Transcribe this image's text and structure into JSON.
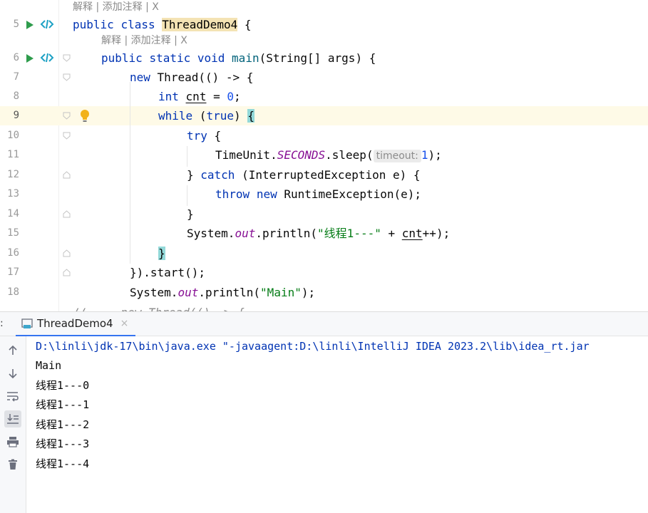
{
  "editor": {
    "hints": [
      "解释 | 添加注释 | X",
      "解释 | 添加注释 | X"
    ],
    "line_numbers": [
      "5",
      "6",
      "7",
      "8",
      "9",
      "10",
      "11",
      "12",
      "13",
      "14",
      "15",
      "16",
      "17",
      "18"
    ],
    "current_line": "9",
    "tokens": {
      "public": "public",
      "class": "class",
      "static": "static",
      "void": "void",
      "new": "new",
      "int": "int",
      "while": "while",
      "true": "true",
      "try": "try",
      "catch": "catch",
      "throw": "throw",
      "class_name": "ThreadDemo4",
      "main": "main",
      "thread": "Thread",
      "main_params": "(String[] args) {",
      "brace_open": " {",
      "thread_lambda": "(() -> {",
      "cnt": "cnt",
      "eq_zero_pre": " = ",
      "zero": "0",
      "semi": ";",
      "while_paren": " (",
      "close_paren": ") ",
      "brace": "{",
      "try_brace": " {",
      "timeunit": "TimeUnit.",
      "seconds": "SECONDS",
      "sleep": ".sleep(",
      "timeout_hint": "timeout:",
      "one": "1",
      "sleep_end": ");",
      "close_brace_catch": "} ",
      "catch_args": " (InterruptedException e) {",
      "runtime_ex": " RuntimeException(e);",
      "close_brace": "}",
      "system": "System.",
      "out": "out",
      "println": ".println(",
      "str_thread": "\"线程1---\"",
      "plus": " + ",
      "inc": "++);",
      "close_start": "}).start();",
      "str_main": "\"Main\"",
      "println_end": ");",
      "partial_line": "//     new Thread(() -> {"
    }
  },
  "run": {
    "colon": ":",
    "tab_title": "ThreadDemo4",
    "tab_close": "×",
    "toolbar": [
      "up-arrow",
      "down-arrow",
      "soft-wrap",
      "scroll-to-end",
      "print",
      "trash"
    ],
    "console_lines": [
      "D:\\linli\\jdk-17\\bin\\java.exe \"-javaagent:D:\\linli\\IntelliJ IDEA 2023.2\\lib\\idea_rt.jar",
      "Main",
      "线程1---0",
      "线程1---1",
      "线程1---2",
      "线程1---3",
      "线程1---4"
    ]
  },
  "colors": {
    "keyword": "#0033b3",
    "string": "#067d17",
    "number": "#1750eb",
    "static_field": "#871094",
    "run_icon": "#2e9c4c",
    "current_line_bg": "#fefae7",
    "tab_accent": "#3574f0"
  }
}
